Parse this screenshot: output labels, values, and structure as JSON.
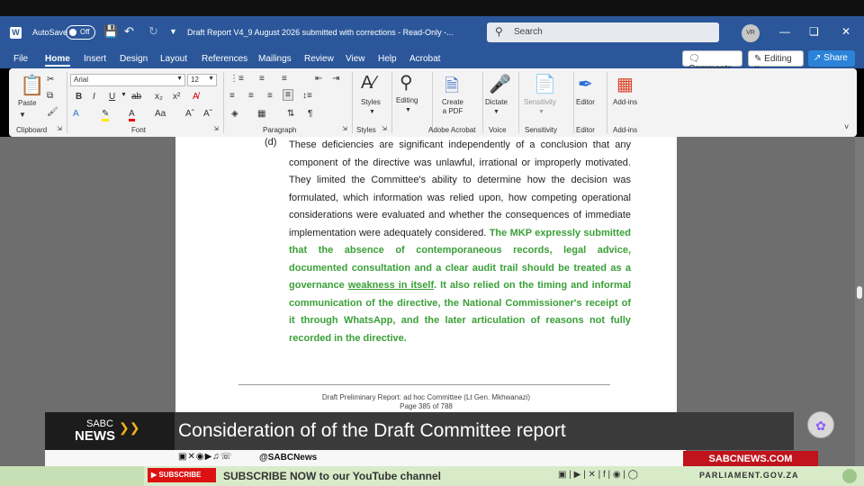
{
  "titlebar": {
    "autosave_label": "AutoSave",
    "autosave_state": "Off",
    "document_title": "Draft Report V4_9 August 2026 submitted with corrections  -  Read-Only  -...",
    "search_placeholder": "Search",
    "user_initials": "VR"
  },
  "menu": {
    "tabs": [
      "File",
      "Home",
      "Insert",
      "Design",
      "Layout",
      "References",
      "Mailings",
      "Review",
      "View",
      "Help",
      "Acrobat"
    ],
    "comments_label": "Comments",
    "editing_label": "Editing",
    "share_label": "Share"
  },
  "ribbon": {
    "paste_label": "Paste",
    "font_name": "Arial",
    "font_size": "12",
    "styles_label": "Styles",
    "editing_label": "Editing",
    "create_pdf_label": "Create a PDF",
    "dictate_label": "Dictate",
    "sensitivity_label": "Sensitivity",
    "editor_label": "Editor",
    "addins_label": "Add-ins",
    "groups": [
      "Clipboard",
      "Font",
      "Paragraph",
      "Styles",
      "Adobe Acrobat",
      "Voice",
      "Sensitivity",
      "Editor",
      "Add-ins"
    ]
  },
  "document": {
    "para_label": "(d)",
    "para_plain": "These deficiencies are significant independently of a conclusion that any component of the directive was unlawful, irrational or improperly motivated. They limited the Committee's ability to determine how the decision was formulated, which information was relied upon, how competing operational considerations were evaluated and whether the consequences of immediate implementation were adequately considered.",
    "para_green_1": "The MKP expressly submitted that the absence of contemporaneous records, legal advice, documented consultation and a clear audit trail should be treated as a governance",
    "para_green_ul": "weakness in itself",
    "para_green_2": ". It also relied on the timing and informal communication of the directive, the National Commissioner's receipt of it through WhatsApp, and the later articulation of reasons not fully recorded in the directive.",
    "footer_line1": "Draft Preliminary Report: ad hoc Committee (Lt Gen. Mkhwanazi)",
    "footer_line2": "Page 385 of 788"
  },
  "broadcast": {
    "logo_top": "SABC",
    "logo_bottom": "NEWS",
    "headline": "Consideration of of the Draft Committee report",
    "social_handle": "@SABCNews",
    "site_badge": "SABCNEWS.COM",
    "subscribe_button": "SUBSCRIBE",
    "ticker_message": "SUBSCRIBE NOW to our YouTube channel",
    "parliament_site": "PARLIAMENT.GOV.ZA"
  },
  "colors": {
    "word_blue": "#2b579a",
    "green_text": "#3aa037",
    "sabc_red": "#c0131b"
  }
}
